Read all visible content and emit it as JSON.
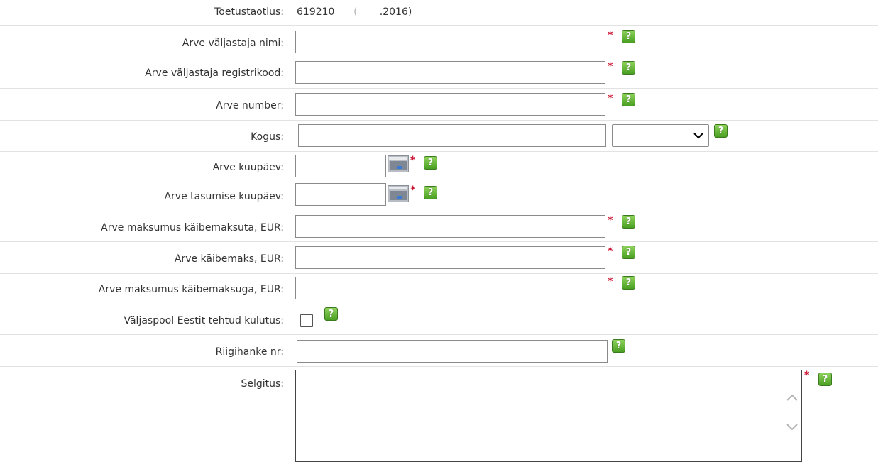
{
  "form": {
    "toetustaotlus": {
      "label": "Toetustaotlus:",
      "value_prefix": "619210",
      "value_masked": "      (       ",
      "value_suffix": ".2016)"
    },
    "fields": [
      {
        "key": "issuer_name",
        "label": "Arve väljastaja nimi:",
        "value": "",
        "required": true
      },
      {
        "key": "issuer_regcode",
        "label": "Arve väljastaja registrikood:",
        "value": "",
        "required": true
      },
      {
        "key": "invoice_number",
        "label": "Arve number:",
        "value": "",
        "required": true
      },
      {
        "key": "quantity",
        "label": "Kogus:",
        "value": "",
        "unit_selected": "",
        "required": false
      },
      {
        "key": "invoice_date",
        "label": "Arve kuupäev:",
        "value": "",
        "required": true
      },
      {
        "key": "payment_date",
        "label": "Arve tasumise kuupäev:",
        "value": "",
        "required": true
      },
      {
        "key": "amount_ex_vat",
        "label": "Arve maksumus käibemaksuta, EUR:",
        "value": "",
        "required": true
      },
      {
        "key": "vat",
        "label": "Arve käibemaks, EUR:",
        "value": "",
        "required": true
      },
      {
        "key": "amount_inc_vat",
        "label": "Arve maksumus käibemaksuga, EUR:",
        "value": "",
        "required": true
      },
      {
        "key": "outside_estonia",
        "label": "Väljaspool Eestit tehtud kulutus:",
        "checked": false
      },
      {
        "key": "procurement_nr",
        "label": "Riigihanke nr:",
        "value": "",
        "required": false
      },
      {
        "key": "explanation",
        "label": "Selgitus:",
        "value": "",
        "required": true
      }
    ],
    "required_mark": "*",
    "help_glyph": "?"
  },
  "icons": {
    "help": "help-icon",
    "calendar": "calendar-icon",
    "chevron": "chevron-down-icon",
    "scroll_up": "scroll-up-icon",
    "scroll_down": "scroll-down-icon"
  },
  "colors": {
    "required": "#c8102e",
    "help_bg": "#5aad2a",
    "border": "#8a8a8a"
  }
}
